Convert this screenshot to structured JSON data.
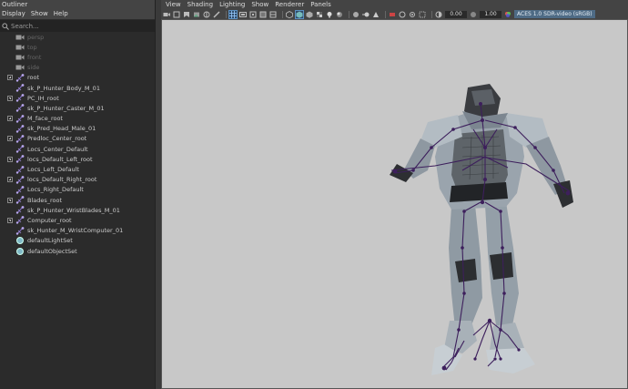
{
  "outliner": {
    "title": "Outliner",
    "menus": [
      "Display",
      "Show",
      "Help"
    ],
    "search_placeholder": "Search...",
    "items": [
      {
        "label": "persp",
        "icon": "camera-icon",
        "expandable": false,
        "dim": true
      },
      {
        "label": "top",
        "icon": "camera-icon",
        "expandable": false,
        "dim": true
      },
      {
        "label": "front",
        "icon": "camera-icon",
        "expandable": false,
        "dim": true
      },
      {
        "label": "side",
        "icon": "camera-icon",
        "expandable": false,
        "dim": true
      },
      {
        "label": "root",
        "icon": "joint-icon",
        "expandable": true
      },
      {
        "label": "sk_P_Hunter_Body_M_01",
        "icon": "joint-icon",
        "expandable": false
      },
      {
        "label": "PC_IH_root",
        "icon": "joint-icon",
        "expandable": true
      },
      {
        "label": "sk_P_Hunter_Caster_M_01",
        "icon": "joint-icon",
        "expandable": false
      },
      {
        "label": "M_face_root",
        "icon": "joint-icon",
        "expandable": true
      },
      {
        "label": "sk_Pred_Head_Male_01",
        "icon": "joint-icon",
        "expandable": false
      },
      {
        "label": "Predloc_Center_root",
        "icon": "joint-icon",
        "expandable": true
      },
      {
        "label": "Locs_Center_Default",
        "icon": "joint-icon",
        "expandable": false
      },
      {
        "label": "locs_Default_Left_root",
        "icon": "joint-icon",
        "expandable": true
      },
      {
        "label": "Locs_Left_Default",
        "icon": "joint-icon",
        "expandable": false
      },
      {
        "label": "locs_Default_Right_root",
        "icon": "joint-icon",
        "expandable": true
      },
      {
        "label": "Locs_Right_Default",
        "icon": "joint-icon",
        "expandable": false
      },
      {
        "label": "Blades_root",
        "icon": "joint-icon",
        "expandable": true
      },
      {
        "label": "sk_P_Hunter_WristBlades_M_01",
        "icon": "joint-icon",
        "expandable": false
      },
      {
        "label": "Computer_root",
        "icon": "joint-icon",
        "expandable": true
      },
      {
        "label": "sk_Hunter_M_WristComputer_01",
        "icon": "joint-icon",
        "expandable": false
      },
      {
        "label": "defaultLightSet",
        "icon": "set-icon",
        "expandable": false
      },
      {
        "label": "defaultObjectSet",
        "icon": "set-icon",
        "expandable": false
      }
    ]
  },
  "viewport": {
    "menus": [
      "View",
      "Shading",
      "Lighting",
      "Show",
      "Renderer",
      "Panels"
    ],
    "exposure_value": "0.00",
    "gamma_value": "1.00",
    "color_space": "ACES 1.0 SDR-video (sRGB)"
  },
  "colors": {
    "viewport_bg": "#c8c8c8",
    "panel_bg": "#2b2b2b",
    "joint_purple": "#3d1f5c",
    "armor_light": "#aab3bb",
    "armor_dark": "#2b2d30"
  }
}
